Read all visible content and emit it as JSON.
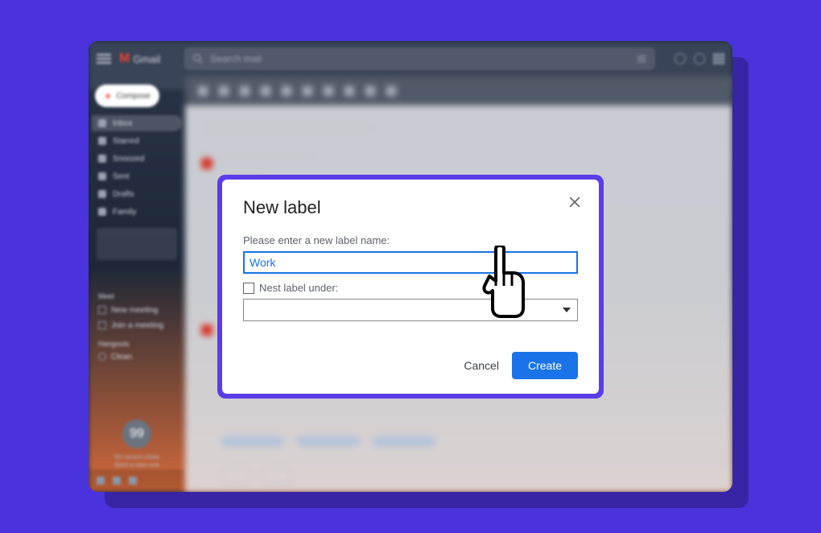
{
  "app": {
    "name": "Gmail"
  },
  "header": {
    "search_placeholder": "Search mail"
  },
  "sidebar": {
    "compose_label": "Compose",
    "items": [
      {
        "label": "Inbox"
      },
      {
        "label": "Starred"
      },
      {
        "label": "Snoozed"
      },
      {
        "label": "Sent"
      },
      {
        "label": "Drafts"
      },
      {
        "label": "Family"
      }
    ],
    "meet_label": "Meet",
    "meet_items": [
      {
        "label": "New meeting"
      },
      {
        "label": "Join a meeting"
      }
    ],
    "hangouts_label": "Hangouts",
    "status_user": "Clean",
    "bubble_glyph": "99",
    "bubble_line1": "No recent chats",
    "bubble_line2": "Start a new one"
  },
  "dialog": {
    "title": "New label",
    "prompt": "Please enter a new label name:",
    "input_value": "Work",
    "nest_label": "Nest label under:",
    "nest_checked": false,
    "cancel_label": "Cancel",
    "create_label": "Create"
  },
  "colors": {
    "page_bg": "#4a32dd",
    "modal_border": "#5c3ce8",
    "primary_blue": "#1a73e8"
  }
}
